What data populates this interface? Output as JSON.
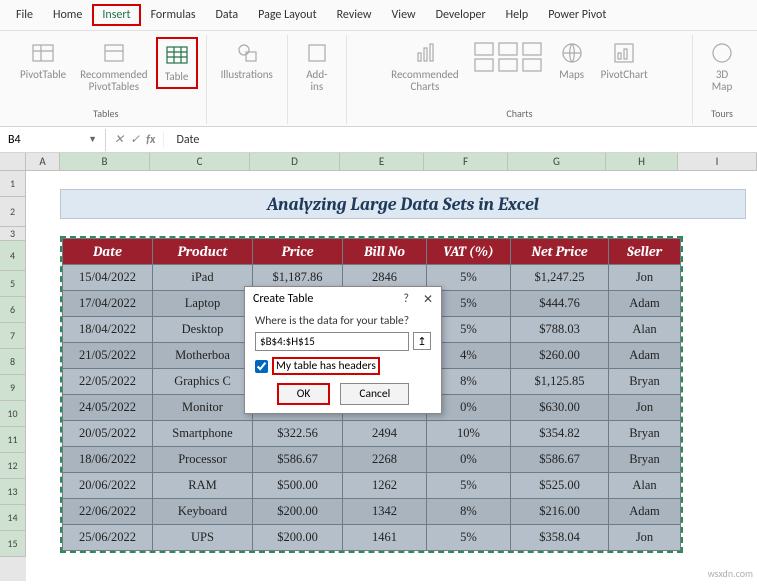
{
  "menu": [
    "File",
    "Home",
    "Insert",
    "Formulas",
    "Data",
    "Page Layout",
    "Review",
    "View",
    "Developer",
    "Help",
    "Power Pivot"
  ],
  "menu_active": "Insert",
  "ribbon": {
    "groups": [
      {
        "label": "Tables",
        "buttons": [
          {
            "name": "pivot",
            "label": "PivotTable"
          },
          {
            "name": "recpivot",
            "label": "Recommended\nPivotTables"
          },
          {
            "name": "table",
            "label": "Table",
            "hl": true
          }
        ]
      },
      {
        "label": "",
        "buttons": [
          {
            "name": "illus",
            "label": "Illustrations"
          }
        ]
      },
      {
        "label": "",
        "buttons": [
          {
            "name": "addins",
            "label": "Add-\nins"
          }
        ]
      },
      {
        "label": "Charts",
        "buttons": [
          {
            "name": "reccharts",
            "label": "Recommended\nCharts"
          },
          {
            "name": "mini",
            "label": ""
          },
          {
            "name": "maps",
            "label": "Maps"
          },
          {
            "name": "pivchart",
            "label": "PivotChart"
          }
        ]
      },
      {
        "label": "Tours",
        "buttons": [
          {
            "name": "3dmap",
            "label": "3D\nMap"
          }
        ]
      }
    ]
  },
  "namebox": "B4",
  "fx_value": "Date",
  "columns": [
    "A",
    "B",
    "C",
    "D",
    "E",
    "F",
    "G",
    "H",
    "I"
  ],
  "row_numbers": [
    "1",
    "2",
    "3",
    "4",
    "5",
    "6",
    "7",
    "8",
    "9",
    "10",
    "11",
    "12",
    "13",
    "14",
    "15"
  ],
  "title_cell": "Analyzing Large Data Sets in Excel",
  "headers": [
    "Date",
    "Product",
    "Price",
    "Bill No",
    "VAT (%)",
    "Net Price",
    "Seller"
  ],
  "rows": [
    [
      "15/04/2022",
      "iPad",
      "$1,187.86",
      "2846",
      "5%",
      "$1,247.25",
      "Jon"
    ],
    [
      "17/04/2022",
      "Laptop",
      "",
      "",
      "5%",
      "$444.76",
      "Adam"
    ],
    [
      "18/04/2022",
      "Desktop",
      "",
      "",
      "5%",
      "$788.03",
      "Alan"
    ],
    [
      "21/05/2022",
      "Motherboa",
      "",
      "",
      "4%",
      "$260.00",
      "Adam"
    ],
    [
      "22/05/2022",
      "Graphics C",
      "",
      "",
      "8%",
      "$1,125.85",
      "Bryan"
    ],
    [
      "24/05/2022",
      "Monitor",
      "$630.00",
      "2024",
      "0%",
      "$630.00",
      "Jon"
    ],
    [
      "20/05/2022",
      "Smartphone",
      "$322.56",
      "2494",
      "10%",
      "$354.82",
      "Bryan"
    ],
    [
      "18/06/2022",
      "Processor",
      "$586.67",
      "2268",
      "0%",
      "$586.67",
      "Bryan"
    ],
    [
      "20/06/2022",
      "RAM",
      "$500.00",
      "1262",
      "5%",
      "$525.00",
      "Alan"
    ],
    [
      "22/06/2022",
      "Keyboard",
      "$200.00",
      "1342",
      "8%",
      "$216.00",
      "Adam"
    ],
    [
      "25/06/2022",
      "UPS",
      "$200.00",
      "1461",
      "5%",
      "$358.04",
      "Jon"
    ]
  ],
  "dialog": {
    "title": "Create Table",
    "help": "?",
    "close": "✕",
    "question": "Where is the data for your table?",
    "range": "$B$4:$H$15",
    "checkbox_label": "My table has headers",
    "ok": "OK",
    "cancel": "Cancel"
  },
  "watermark": "wsxdn.com"
}
